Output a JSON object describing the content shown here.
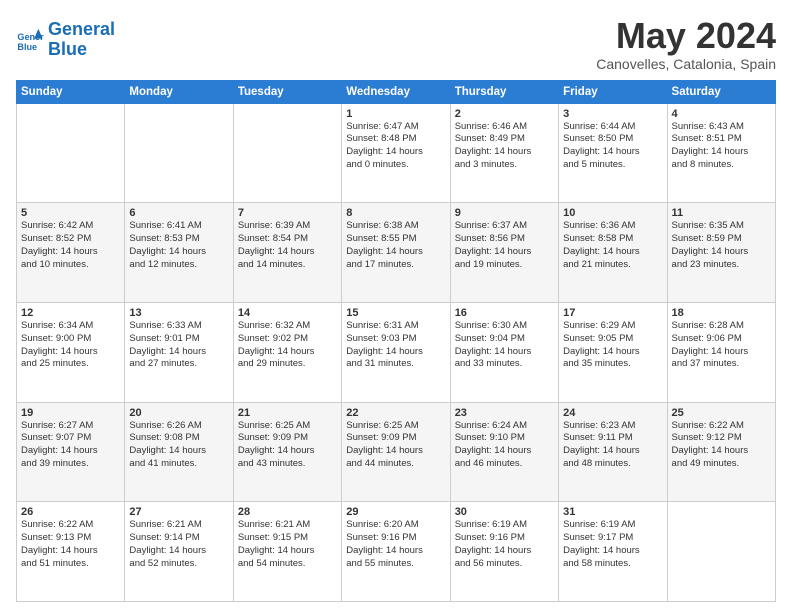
{
  "logo": {
    "line1": "General",
    "line2": "Blue"
  },
  "title": "May 2024",
  "location": "Canovelles, Catalonia, Spain",
  "days_of_week": [
    "Sunday",
    "Monday",
    "Tuesday",
    "Wednesday",
    "Thursday",
    "Friday",
    "Saturday"
  ],
  "weeks": [
    [
      {
        "day": "",
        "info": ""
      },
      {
        "day": "",
        "info": ""
      },
      {
        "day": "",
        "info": ""
      },
      {
        "day": "1",
        "info": "Sunrise: 6:47 AM\nSunset: 8:48 PM\nDaylight: 14 hours\nand 0 minutes."
      },
      {
        "day": "2",
        "info": "Sunrise: 6:46 AM\nSunset: 8:49 PM\nDaylight: 14 hours\nand 3 minutes."
      },
      {
        "day": "3",
        "info": "Sunrise: 6:44 AM\nSunset: 8:50 PM\nDaylight: 14 hours\nand 5 minutes."
      },
      {
        "day": "4",
        "info": "Sunrise: 6:43 AM\nSunset: 8:51 PM\nDaylight: 14 hours\nand 8 minutes."
      }
    ],
    [
      {
        "day": "5",
        "info": "Sunrise: 6:42 AM\nSunset: 8:52 PM\nDaylight: 14 hours\nand 10 minutes."
      },
      {
        "day": "6",
        "info": "Sunrise: 6:41 AM\nSunset: 8:53 PM\nDaylight: 14 hours\nand 12 minutes."
      },
      {
        "day": "7",
        "info": "Sunrise: 6:39 AM\nSunset: 8:54 PM\nDaylight: 14 hours\nand 14 minutes."
      },
      {
        "day": "8",
        "info": "Sunrise: 6:38 AM\nSunset: 8:55 PM\nDaylight: 14 hours\nand 17 minutes."
      },
      {
        "day": "9",
        "info": "Sunrise: 6:37 AM\nSunset: 8:56 PM\nDaylight: 14 hours\nand 19 minutes."
      },
      {
        "day": "10",
        "info": "Sunrise: 6:36 AM\nSunset: 8:58 PM\nDaylight: 14 hours\nand 21 minutes."
      },
      {
        "day": "11",
        "info": "Sunrise: 6:35 AM\nSunset: 8:59 PM\nDaylight: 14 hours\nand 23 minutes."
      }
    ],
    [
      {
        "day": "12",
        "info": "Sunrise: 6:34 AM\nSunset: 9:00 PM\nDaylight: 14 hours\nand 25 minutes."
      },
      {
        "day": "13",
        "info": "Sunrise: 6:33 AM\nSunset: 9:01 PM\nDaylight: 14 hours\nand 27 minutes."
      },
      {
        "day": "14",
        "info": "Sunrise: 6:32 AM\nSunset: 9:02 PM\nDaylight: 14 hours\nand 29 minutes."
      },
      {
        "day": "15",
        "info": "Sunrise: 6:31 AM\nSunset: 9:03 PM\nDaylight: 14 hours\nand 31 minutes."
      },
      {
        "day": "16",
        "info": "Sunrise: 6:30 AM\nSunset: 9:04 PM\nDaylight: 14 hours\nand 33 minutes."
      },
      {
        "day": "17",
        "info": "Sunrise: 6:29 AM\nSunset: 9:05 PM\nDaylight: 14 hours\nand 35 minutes."
      },
      {
        "day": "18",
        "info": "Sunrise: 6:28 AM\nSunset: 9:06 PM\nDaylight: 14 hours\nand 37 minutes."
      }
    ],
    [
      {
        "day": "19",
        "info": "Sunrise: 6:27 AM\nSunset: 9:07 PM\nDaylight: 14 hours\nand 39 minutes."
      },
      {
        "day": "20",
        "info": "Sunrise: 6:26 AM\nSunset: 9:08 PM\nDaylight: 14 hours\nand 41 minutes."
      },
      {
        "day": "21",
        "info": "Sunrise: 6:25 AM\nSunset: 9:09 PM\nDaylight: 14 hours\nand 43 minutes."
      },
      {
        "day": "22",
        "info": "Sunrise: 6:25 AM\nSunset: 9:09 PM\nDaylight: 14 hours\nand 44 minutes."
      },
      {
        "day": "23",
        "info": "Sunrise: 6:24 AM\nSunset: 9:10 PM\nDaylight: 14 hours\nand 46 minutes."
      },
      {
        "day": "24",
        "info": "Sunrise: 6:23 AM\nSunset: 9:11 PM\nDaylight: 14 hours\nand 48 minutes."
      },
      {
        "day": "25",
        "info": "Sunrise: 6:22 AM\nSunset: 9:12 PM\nDaylight: 14 hours\nand 49 minutes."
      }
    ],
    [
      {
        "day": "26",
        "info": "Sunrise: 6:22 AM\nSunset: 9:13 PM\nDaylight: 14 hours\nand 51 minutes."
      },
      {
        "day": "27",
        "info": "Sunrise: 6:21 AM\nSunset: 9:14 PM\nDaylight: 14 hours\nand 52 minutes."
      },
      {
        "day": "28",
        "info": "Sunrise: 6:21 AM\nSunset: 9:15 PM\nDaylight: 14 hours\nand 54 minutes."
      },
      {
        "day": "29",
        "info": "Sunrise: 6:20 AM\nSunset: 9:16 PM\nDaylight: 14 hours\nand 55 minutes."
      },
      {
        "day": "30",
        "info": "Sunrise: 6:19 AM\nSunset: 9:16 PM\nDaylight: 14 hours\nand 56 minutes."
      },
      {
        "day": "31",
        "info": "Sunrise: 6:19 AM\nSunset: 9:17 PM\nDaylight: 14 hours\nand 58 minutes."
      },
      {
        "day": "",
        "info": ""
      }
    ]
  ]
}
